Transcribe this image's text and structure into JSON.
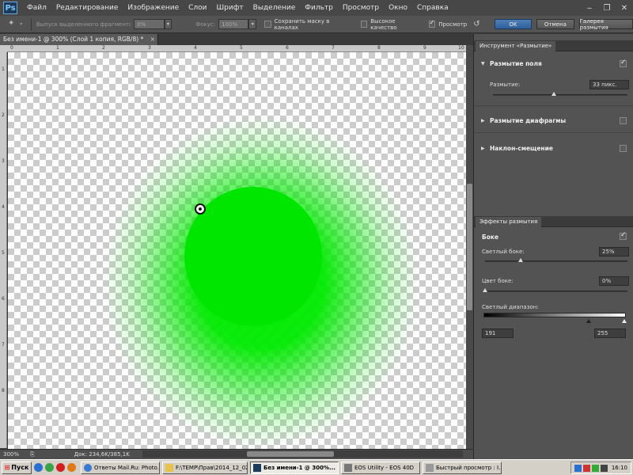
{
  "app": {
    "logo": "Ps"
  },
  "menu": [
    "Файл",
    "Редактирование",
    "Изображение",
    "Слои",
    "Шрифт",
    "Выделение",
    "Фильтр",
    "Просмотр",
    "Окно",
    "Справка"
  ],
  "window_controls": {
    "minimize": "‒",
    "restore": "❐",
    "close": "✕"
  },
  "options": {
    "selection_label": "Выпуск выделенного фрагмента за обрез:",
    "selection_value": "0%",
    "focus_label": "Фокус:",
    "focus_value": "100%",
    "save_mask_label": "Сохранить маску в каналах",
    "high_quality_label": "Высокое качество",
    "preview_label": "Просмотр",
    "ok_label": "OK",
    "cancel_label": "Отмена",
    "gallery_label": "Галерея размытия"
  },
  "document": {
    "tab_title": "Без имени-1 @ 300% (Слой 1 копия, RGB/8) *",
    "close": "×",
    "ruler_top": [
      "0",
      "1",
      "2",
      "3",
      "4",
      "5",
      "6",
      "7",
      "8",
      "9",
      "10"
    ],
    "ruler_left": [
      "1",
      "2",
      "3",
      "4",
      "5",
      "6",
      "7",
      "8"
    ],
    "zoom": "300%",
    "doc_info": "Док: 234,6K/385,1K",
    "colors": {
      "blur": "#00e600"
    }
  },
  "blur_tools": {
    "header": "Инструмент «Размытие»",
    "field_blur": {
      "title": "Размытие поля",
      "checked": true,
      "blur_label": "Размытие:",
      "blur_value": "33 пикс.",
      "slider": 0.45
    },
    "iris_blur": {
      "title": "Размытие диафрагмы",
      "checked": false
    },
    "tilt_shift": {
      "title": "Наклон-смещение",
      "checked": false
    }
  },
  "blur_effects": {
    "header": "Эффекты размытия",
    "bokeh_title": "Боке",
    "bokeh_checked": true,
    "light_bokeh_label": "Светлый боке:",
    "light_bokeh_value": "25%",
    "light_bokeh_slider": 0.25,
    "bokeh_color_label": "Цвет боке:",
    "bokeh_color_value": "0%",
    "bokeh_color_slider": 0,
    "light_range_label": "Светлый диапазон:",
    "range_low": "191",
    "range_high": "255"
  },
  "taskbar": {
    "start": "Пуск",
    "tasks": [
      "Ответы Mail.Ru: Photo...",
      "F:\\TEMP\\Прав\\2014_12_02",
      "Без имени-1 @ 300%...",
      "EOS Utility - EOS 40D",
      "Быстрый просмотр : I..."
    ],
    "active_task": 2,
    "clock": "16:10"
  }
}
